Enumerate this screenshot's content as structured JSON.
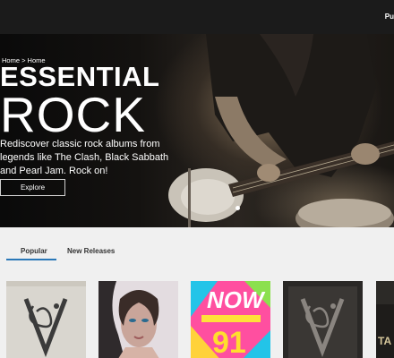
{
  "topbar": {
    "right_label": "Pu"
  },
  "hero": {
    "breadcrumb": "Home > Home",
    "title_line1": "ESSENTIAL",
    "title_line2": "ROCK",
    "description": "Rediscover classic rock albums from legends like The Clash, Black Sabbath and Pearl Jam. Rock on!",
    "explore_label": "Explore"
  },
  "tabs": [
    {
      "label": "Popular",
      "active": true
    },
    {
      "label": "New Releases",
      "active": false
    }
  ],
  "albums": [
    {
      "art": "bring-me-the-horizon-that's-the-spirit-cover"
    },
    {
      "art": "portrait-cover"
    },
    {
      "art": "now-that's-what-i-call-music-91-cover",
      "line1": "NOW",
      "line2": "91"
    },
    {
      "art": "bring-me-the-horizon-dark-cover"
    },
    {
      "art": "partial-cover",
      "text": "TA"
    }
  ],
  "colors": {
    "accent": "#2a78b8",
    "topbar": "#1b1b1b",
    "background": "#f0f0f0"
  }
}
